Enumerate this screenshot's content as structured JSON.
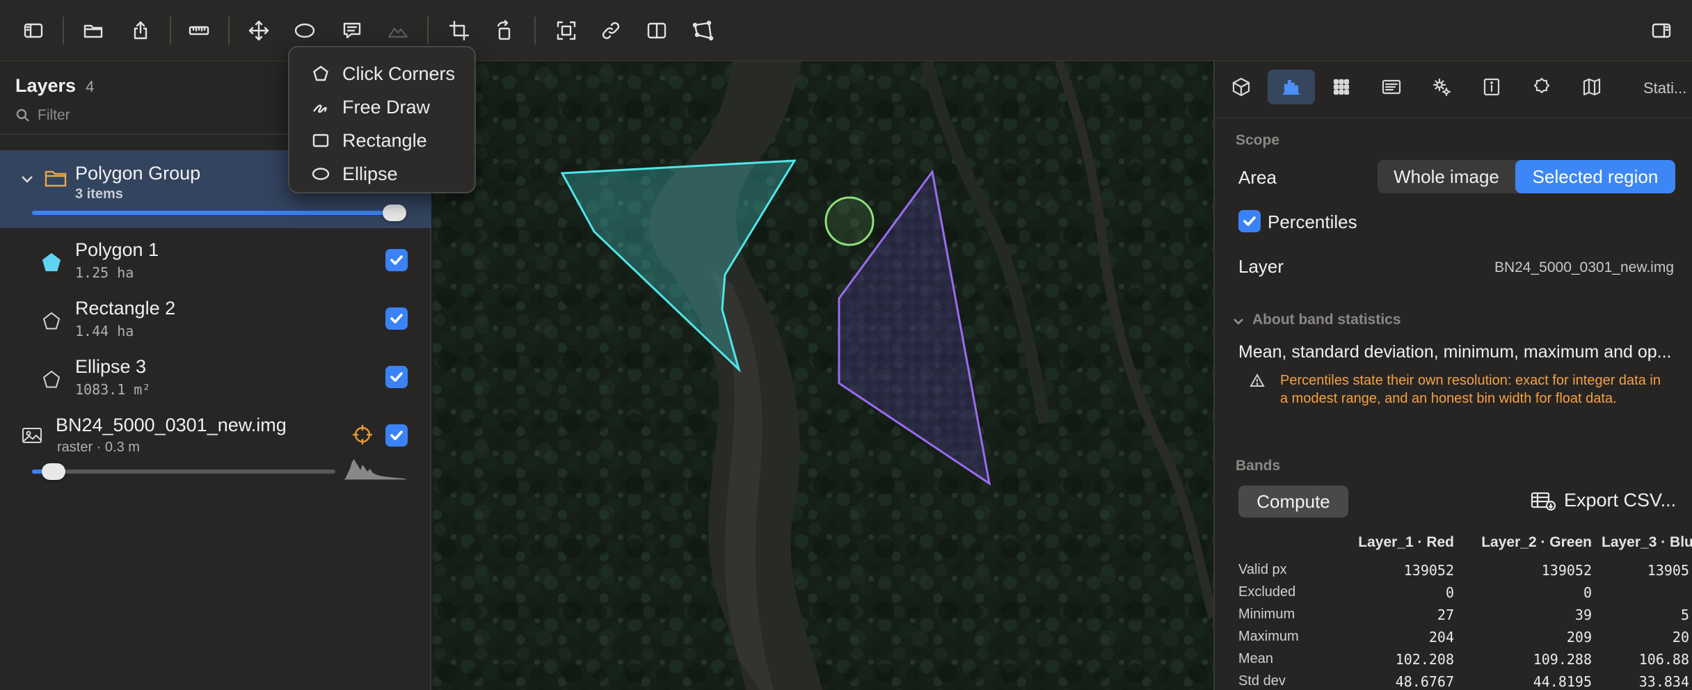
{
  "toolbar": {
    "icons": [
      "sidebar-left-icon",
      "folder-icon",
      "share-icon",
      "ruler-icon",
      "move-icon",
      "ellipse-icon",
      "comment-icon",
      "terrain-icon",
      "crop-icon",
      "rotate-icon",
      "fit-icon",
      "link-icon",
      "split-view-icon",
      "distort-icon",
      "sidebar-right-icon"
    ]
  },
  "layers": {
    "title": "Layers",
    "count": "4",
    "filter_placeholder": "Filter",
    "group": {
      "name": "Polygon Group",
      "sub": "3 items",
      "opacity": 1.0
    },
    "items": [
      {
        "name": "Polygon 1",
        "sub": "1.25 ha",
        "icon": "pentagon-filled-icon",
        "color": "#5fd3ef",
        "checked": true
      },
      {
        "name": "Rectangle 2",
        "sub": "1.44 ha",
        "icon": "pentagon-outline-icon",
        "checked": true
      },
      {
        "name": "Ellipse 3",
        "sub": "1083.1 m²",
        "icon": "pentagon-outline-icon",
        "checked": true
      }
    ],
    "raster": {
      "name": "BN24_5000_0301_new.img",
      "sub": "raster · 0.3 m",
      "opacity": 0.07,
      "checked": true
    }
  },
  "dropdown": {
    "items": [
      {
        "label": "Click Corners",
        "icon": "pentagon-icon"
      },
      {
        "label": "Free Draw",
        "icon": "freehand-icon"
      },
      {
        "label": "Rectangle",
        "icon": "rectangle-icon"
      },
      {
        "label": "Ellipse",
        "icon": "ellipse-icon"
      }
    ]
  },
  "map": {
    "polygon_cyan": "#4ee6e8",
    "polygon_purple": "#9a6cf0",
    "circle_green": "#8ee07a"
  },
  "right": {
    "tab_text": "Stati...",
    "scope_label": "Scope",
    "area_label": "Area",
    "area_options": [
      "Whole image",
      "Selected region"
    ],
    "area_selected": "Selected region",
    "percentiles_label": "Percentiles",
    "percentiles_checked": true,
    "layer_label": "Layer",
    "layer_value": "BN24_5000_0301_new.img",
    "about_label": "About band statistics",
    "about_text": "Mean, standard deviation, minimum, maximum and op...",
    "warning_text": "Percentiles state their own resolution: exact for integer data in a modest range, and an honest bin width for float data.",
    "bands_label": "Bands",
    "compute_label": "Compute",
    "export_label": "Export CSV...",
    "accent": "#3d86f5",
    "warning_color": "#f5a142"
  },
  "stats": {
    "columns": [
      "Layer_1 · Red",
      "Layer_2 · Green",
      "Layer_3 · Blu"
    ],
    "rows": [
      {
        "label": "Valid px",
        "values": [
          "139052",
          "139052",
          "13905"
        ]
      },
      {
        "label": "Excluded",
        "values": [
          "0",
          "0",
          ""
        ]
      },
      {
        "label": "Minimum",
        "values": [
          "27",
          "39",
          "5"
        ]
      },
      {
        "label": "Maximum",
        "values": [
          "204",
          "209",
          "20"
        ]
      },
      {
        "label": "Mean",
        "values": [
          "102.208",
          "109.288",
          "106.88"
        ]
      },
      {
        "label": "Std dev",
        "values": [
          "48.6767",
          "44.8195",
          "33.834"
        ]
      }
    ]
  }
}
